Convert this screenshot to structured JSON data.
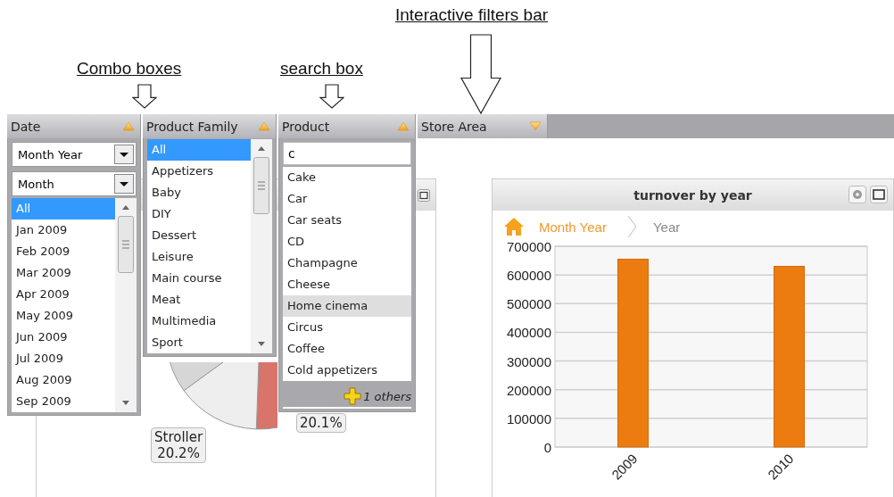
{
  "annotations": [
    {
      "text": "Interactive filters bar",
      "kind": "large"
    },
    {
      "text": "Combo boxes",
      "kind": "small"
    },
    {
      "text": "search box",
      "kind": "small"
    }
  ],
  "filters": [
    {
      "label": "Date",
      "kind": "list",
      "expanded": true,
      "combos": [
        {
          "value": "Month Year"
        },
        {
          "value": "Month"
        }
      ],
      "items": [
        {
          "label": "All",
          "selected": true,
          "hovered": false
        },
        {
          "label": "Jan 2009",
          "selected": false,
          "hovered": false
        },
        {
          "label": "Feb 2009",
          "selected": false,
          "hovered": false
        },
        {
          "label": "Mar 2009",
          "selected": false,
          "hovered": false
        },
        {
          "label": "Apr 2009",
          "selected": false,
          "hovered": false
        },
        {
          "label": "May 2009",
          "selected": false,
          "hovered": false
        },
        {
          "label": "Jun 2009",
          "selected": false,
          "hovered": false
        },
        {
          "label": "Jul 2009",
          "selected": false,
          "hovered": false
        },
        {
          "label": "Aug 2009",
          "selected": false,
          "hovered": false
        },
        {
          "label": "Sep 2009",
          "selected": false,
          "hovered": false
        }
      ]
    },
    {
      "label": "Product Family",
      "kind": "list",
      "expanded": true,
      "items": [
        {
          "label": "All",
          "selected": true,
          "hovered": false
        },
        {
          "label": "Appetizers",
          "selected": false,
          "hovered": false
        },
        {
          "label": "Baby",
          "selected": false,
          "hovered": false
        },
        {
          "label": "DIY",
          "selected": false,
          "hovered": false
        },
        {
          "label": "Dessert",
          "selected": false,
          "hovered": false
        },
        {
          "label": "Leisure",
          "selected": false,
          "hovered": false
        },
        {
          "label": "Main course",
          "selected": false,
          "hovered": false
        },
        {
          "label": "Meat",
          "selected": false,
          "hovered": false
        },
        {
          "label": "Multimedia",
          "selected": false,
          "hovered": false
        },
        {
          "label": "Sport",
          "selected": false,
          "hovered": false
        }
      ]
    },
    {
      "label": "Product",
      "kind": "search",
      "expanded": true,
      "search": {
        "value": "c"
      },
      "items": [
        {
          "label": "Cake",
          "selected": false,
          "hovered": false
        },
        {
          "label": "Car",
          "selected": false,
          "hovered": false
        },
        {
          "label": "Car seats",
          "selected": false,
          "hovered": false
        },
        {
          "label": "CD",
          "selected": false,
          "hovered": false
        },
        {
          "label": "Champagne",
          "selected": false,
          "hovered": false
        },
        {
          "label": "Cheese",
          "selected": false,
          "hovered": false
        },
        {
          "label": "Home cinema",
          "selected": false,
          "hovered": true
        },
        {
          "label": "Circus",
          "selected": false,
          "hovered": false
        },
        {
          "label": "Coffee",
          "selected": false,
          "hovered": false
        },
        {
          "label": "Cold appetizers",
          "selected": false,
          "hovered": false
        }
      ],
      "footer": "1 others"
    },
    {
      "label": "Store Area",
      "expanded": false
    }
  ],
  "left_panel": {
    "pie_labels": [
      {
        "lines": [
          "Stroller",
          "20.2%"
        ]
      },
      {
        "lines": [
          "20.1%"
        ]
      }
    ]
  },
  "chart_panel": {
    "title": "turnover by year",
    "breadcrumb": [
      {
        "label": "Month Year",
        "current": false
      },
      {
        "label": "Year",
        "current": true
      }
    ],
    "chart_data": {
      "type": "bar",
      "categories": [
        "2009",
        "2010"
      ],
      "grid": true,
      "series": [
        {
          "color": "#ec7c10",
          "values": [
            655000,
            630000
          ]
        }
      ],
      "ylim": [
        0,
        700000
      ],
      "yticks": [
        0,
        100000,
        200000,
        300000,
        400000,
        500000,
        600000,
        700000
      ]
    }
  }
}
